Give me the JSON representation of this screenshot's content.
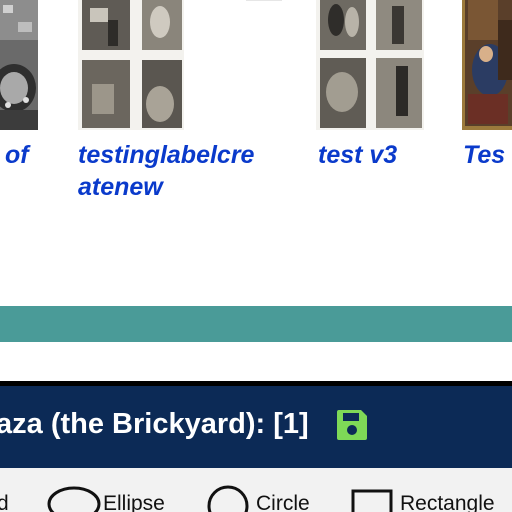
{
  "gallery": {
    "items": [
      {
        "caption": "of"
      },
      {
        "caption_line1": "testinglabelcre",
        "caption_line2": "atenew"
      },
      {
        "caption": "test v3"
      },
      {
        "caption": "Tes"
      }
    ]
  },
  "annotation_panel": {
    "title": "aza (the Brickyard): [1]",
    "save_icon": "floppy-disk-icon",
    "accent_color": "#7ed957",
    "header_color": "#0c2a56"
  },
  "band_color": "#4a9b98",
  "tools": {
    "partial_label": "d",
    "ellipse_label": "Ellipse",
    "circle_label": "Circle",
    "rectangle_label": "Rectangle"
  }
}
